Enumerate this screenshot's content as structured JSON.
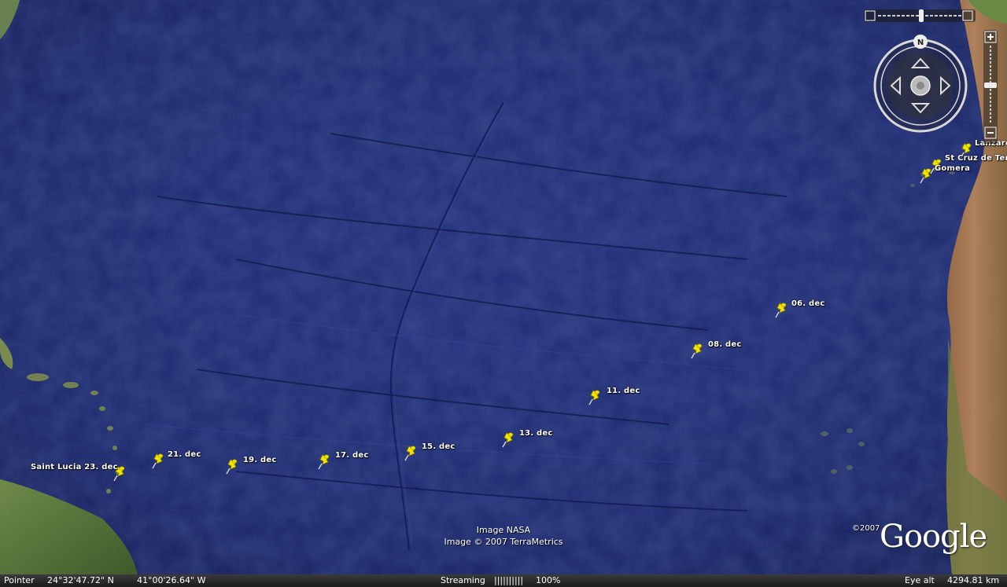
{
  "map": {
    "image_credit": "Image NASA",
    "imagery_credit": "Image © 2007 TerraMetrics",
    "copyright_year": "©2007",
    "logo": "Google",
    "compass_north": "N"
  },
  "placemarks": [
    {
      "label": "06. dec"
    },
    {
      "label": "08. dec"
    },
    {
      "label": "11. dec"
    },
    {
      "label": "13. dec"
    },
    {
      "label": "15. dec"
    },
    {
      "label": "17. dec"
    },
    {
      "label": "19. dec"
    },
    {
      "label": "21. dec"
    },
    {
      "label": "Saint Lucia 23. dec"
    },
    {
      "label": "Lanzaro"
    },
    {
      "label": "St Cruz de Ten"
    },
    {
      "label": "Gomera"
    }
  ],
  "status": {
    "pointer_label": "Pointer",
    "latitude": "24°32'47.72\" N",
    "longitude": "41°00'26.64\" W",
    "streaming_label": "Streaming",
    "streaming_bar": "||||||||||",
    "streaming_percent": "100%",
    "eye_alt_label": "Eye alt",
    "eye_alt_value": "4294.81 km"
  },
  "icons": {
    "placemark": "yellow-pushpin-icon",
    "zoom_in": "plus-icon",
    "zoom_out": "minus-icon",
    "look_up": "chevron-up-icon",
    "look_down": "chevron-down-icon",
    "look_left": "chevron-left-icon",
    "look_right": "chevron-right-icon",
    "reset_north": "compass-n-icon"
  },
  "colors": {
    "ocean": "#1c2a6c",
    "pin": "#f2e600",
    "land_green": "#5a7a3a",
    "land_desert": "#b07a4a"
  }
}
